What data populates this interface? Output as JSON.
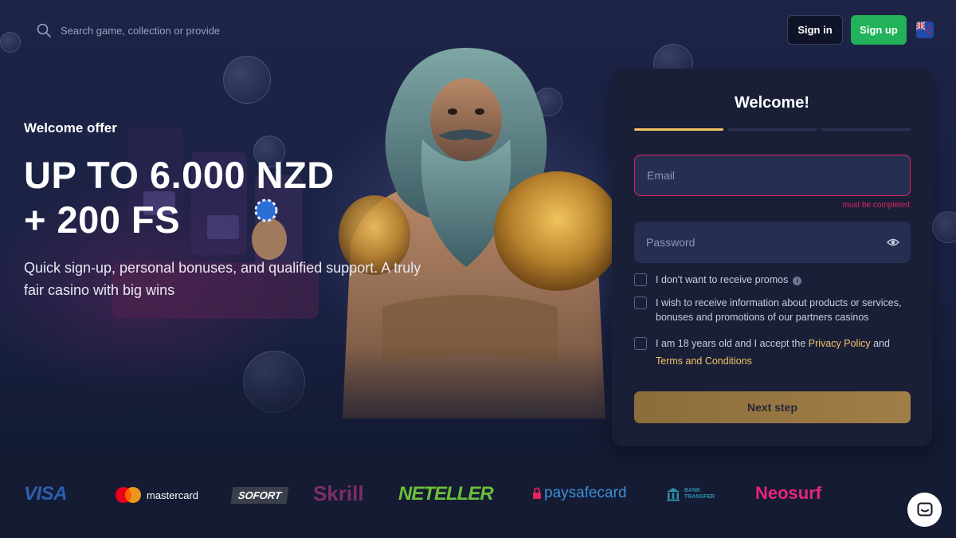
{
  "header": {
    "search_placeholder": "Search game, collection or provider",
    "signin_label": "Sign in",
    "signup_label": "Sign up",
    "language_flag": "nz-flag-icon"
  },
  "hero": {
    "offer_label": "Welcome offer",
    "offer_line1": "UP TO 6.000 NZD",
    "offer_line2": "+ 200 FS",
    "description": "Quick sign-up, personal bonuses, and qualified support. A truly fair casino with big wins"
  },
  "registration": {
    "title": "Welcome!",
    "steps_total": 3,
    "step_active": 1,
    "email_placeholder": "Email",
    "email_error": "must be completed",
    "password_placeholder": "Password",
    "checkbox_promos": "I don't want to receive promos",
    "checkbox_partners": "I wish to receive information about products or services, bonuses and promotions of our partners casinos",
    "checkbox_age_prefix": "I am 18 years old and I accept the",
    "privacy_link": "Privacy Policy",
    "age_and": "and",
    "terms_link": "Terms and Conditions",
    "next_label": "Next step"
  },
  "payments": {
    "visa": "VISA",
    "mastercard": "mastercard",
    "sofort": "SOFORT",
    "skrill": "Skrill",
    "neteller": "NETELLER",
    "paysafecard": "paysafecard",
    "bank_line1": "BANK",
    "bank_line2": "TRANSFER",
    "neosurf": "Neosurf"
  },
  "colors": {
    "background": "#141b33",
    "panel": "#1a1f38",
    "accent_gold": "#f2c463",
    "signup_green": "#21b25a",
    "error_red": "#e0245e"
  },
  "icons": {
    "search": "search-icon",
    "eye": "eye-icon",
    "info": "info-icon",
    "chat": "chat-icon"
  }
}
